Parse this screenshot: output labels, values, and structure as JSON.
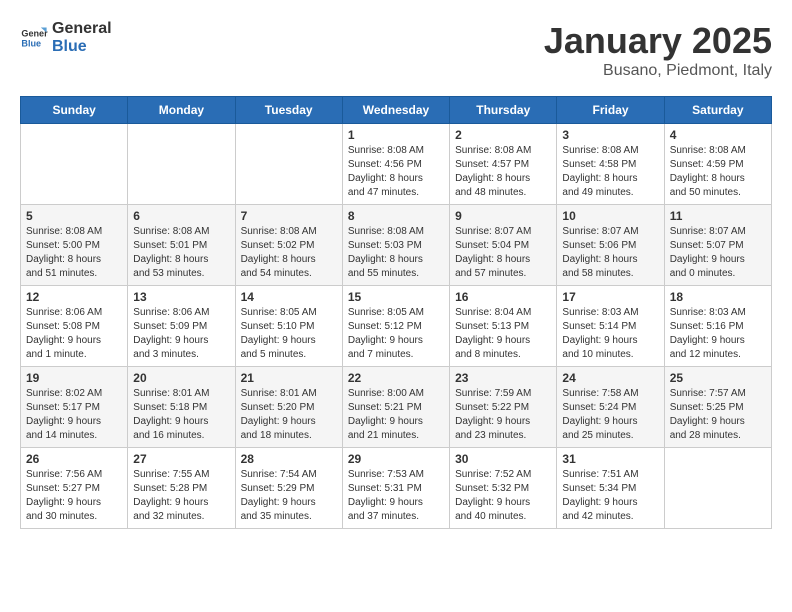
{
  "header": {
    "logo_general": "General",
    "logo_blue": "Blue",
    "month_title": "January 2025",
    "location": "Busano, Piedmont, Italy"
  },
  "weekdays": [
    "Sunday",
    "Monday",
    "Tuesday",
    "Wednesday",
    "Thursday",
    "Friday",
    "Saturday"
  ],
  "weeks": [
    [
      {
        "day": "",
        "info": ""
      },
      {
        "day": "",
        "info": ""
      },
      {
        "day": "",
        "info": ""
      },
      {
        "day": "1",
        "info": "Sunrise: 8:08 AM\nSunset: 4:56 PM\nDaylight: 8 hours\nand 47 minutes."
      },
      {
        "day": "2",
        "info": "Sunrise: 8:08 AM\nSunset: 4:57 PM\nDaylight: 8 hours\nand 48 minutes."
      },
      {
        "day": "3",
        "info": "Sunrise: 8:08 AM\nSunset: 4:58 PM\nDaylight: 8 hours\nand 49 minutes."
      },
      {
        "day": "4",
        "info": "Sunrise: 8:08 AM\nSunset: 4:59 PM\nDaylight: 8 hours\nand 50 minutes."
      }
    ],
    [
      {
        "day": "5",
        "info": "Sunrise: 8:08 AM\nSunset: 5:00 PM\nDaylight: 8 hours\nand 51 minutes."
      },
      {
        "day": "6",
        "info": "Sunrise: 8:08 AM\nSunset: 5:01 PM\nDaylight: 8 hours\nand 53 minutes."
      },
      {
        "day": "7",
        "info": "Sunrise: 8:08 AM\nSunset: 5:02 PM\nDaylight: 8 hours\nand 54 minutes."
      },
      {
        "day": "8",
        "info": "Sunrise: 8:08 AM\nSunset: 5:03 PM\nDaylight: 8 hours\nand 55 minutes."
      },
      {
        "day": "9",
        "info": "Sunrise: 8:07 AM\nSunset: 5:04 PM\nDaylight: 8 hours\nand 57 minutes."
      },
      {
        "day": "10",
        "info": "Sunrise: 8:07 AM\nSunset: 5:06 PM\nDaylight: 8 hours\nand 58 minutes."
      },
      {
        "day": "11",
        "info": "Sunrise: 8:07 AM\nSunset: 5:07 PM\nDaylight: 9 hours\nand 0 minutes."
      }
    ],
    [
      {
        "day": "12",
        "info": "Sunrise: 8:06 AM\nSunset: 5:08 PM\nDaylight: 9 hours\nand 1 minute."
      },
      {
        "day": "13",
        "info": "Sunrise: 8:06 AM\nSunset: 5:09 PM\nDaylight: 9 hours\nand 3 minutes."
      },
      {
        "day": "14",
        "info": "Sunrise: 8:05 AM\nSunset: 5:10 PM\nDaylight: 9 hours\nand 5 minutes."
      },
      {
        "day": "15",
        "info": "Sunrise: 8:05 AM\nSunset: 5:12 PM\nDaylight: 9 hours\nand 7 minutes."
      },
      {
        "day": "16",
        "info": "Sunrise: 8:04 AM\nSunset: 5:13 PM\nDaylight: 9 hours\nand 8 minutes."
      },
      {
        "day": "17",
        "info": "Sunrise: 8:03 AM\nSunset: 5:14 PM\nDaylight: 9 hours\nand 10 minutes."
      },
      {
        "day": "18",
        "info": "Sunrise: 8:03 AM\nSunset: 5:16 PM\nDaylight: 9 hours\nand 12 minutes."
      }
    ],
    [
      {
        "day": "19",
        "info": "Sunrise: 8:02 AM\nSunset: 5:17 PM\nDaylight: 9 hours\nand 14 minutes."
      },
      {
        "day": "20",
        "info": "Sunrise: 8:01 AM\nSunset: 5:18 PM\nDaylight: 9 hours\nand 16 minutes."
      },
      {
        "day": "21",
        "info": "Sunrise: 8:01 AM\nSunset: 5:20 PM\nDaylight: 9 hours\nand 18 minutes."
      },
      {
        "day": "22",
        "info": "Sunrise: 8:00 AM\nSunset: 5:21 PM\nDaylight: 9 hours\nand 21 minutes."
      },
      {
        "day": "23",
        "info": "Sunrise: 7:59 AM\nSunset: 5:22 PM\nDaylight: 9 hours\nand 23 minutes."
      },
      {
        "day": "24",
        "info": "Sunrise: 7:58 AM\nSunset: 5:24 PM\nDaylight: 9 hours\nand 25 minutes."
      },
      {
        "day": "25",
        "info": "Sunrise: 7:57 AM\nSunset: 5:25 PM\nDaylight: 9 hours\nand 28 minutes."
      }
    ],
    [
      {
        "day": "26",
        "info": "Sunrise: 7:56 AM\nSunset: 5:27 PM\nDaylight: 9 hours\nand 30 minutes."
      },
      {
        "day": "27",
        "info": "Sunrise: 7:55 AM\nSunset: 5:28 PM\nDaylight: 9 hours\nand 32 minutes."
      },
      {
        "day": "28",
        "info": "Sunrise: 7:54 AM\nSunset: 5:29 PM\nDaylight: 9 hours\nand 35 minutes."
      },
      {
        "day": "29",
        "info": "Sunrise: 7:53 AM\nSunset: 5:31 PM\nDaylight: 9 hours\nand 37 minutes."
      },
      {
        "day": "30",
        "info": "Sunrise: 7:52 AM\nSunset: 5:32 PM\nDaylight: 9 hours\nand 40 minutes."
      },
      {
        "day": "31",
        "info": "Sunrise: 7:51 AM\nSunset: 5:34 PM\nDaylight: 9 hours\nand 42 minutes."
      },
      {
        "day": "",
        "info": ""
      }
    ]
  ]
}
